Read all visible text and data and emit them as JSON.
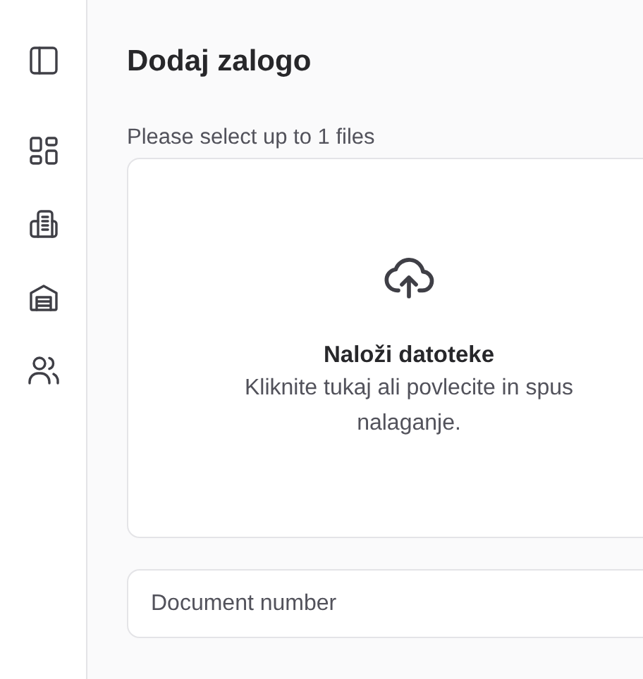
{
  "page": {
    "title": "Dodaj zalogo"
  },
  "upload": {
    "label": "Please select up to 1 files",
    "title": "Naloži datoteke",
    "description_lines": [
      "Kliknite tukaj ali povlecite in spus",
      "nalaganje."
    ]
  },
  "document_number": {
    "placeholder": "Document number"
  }
}
